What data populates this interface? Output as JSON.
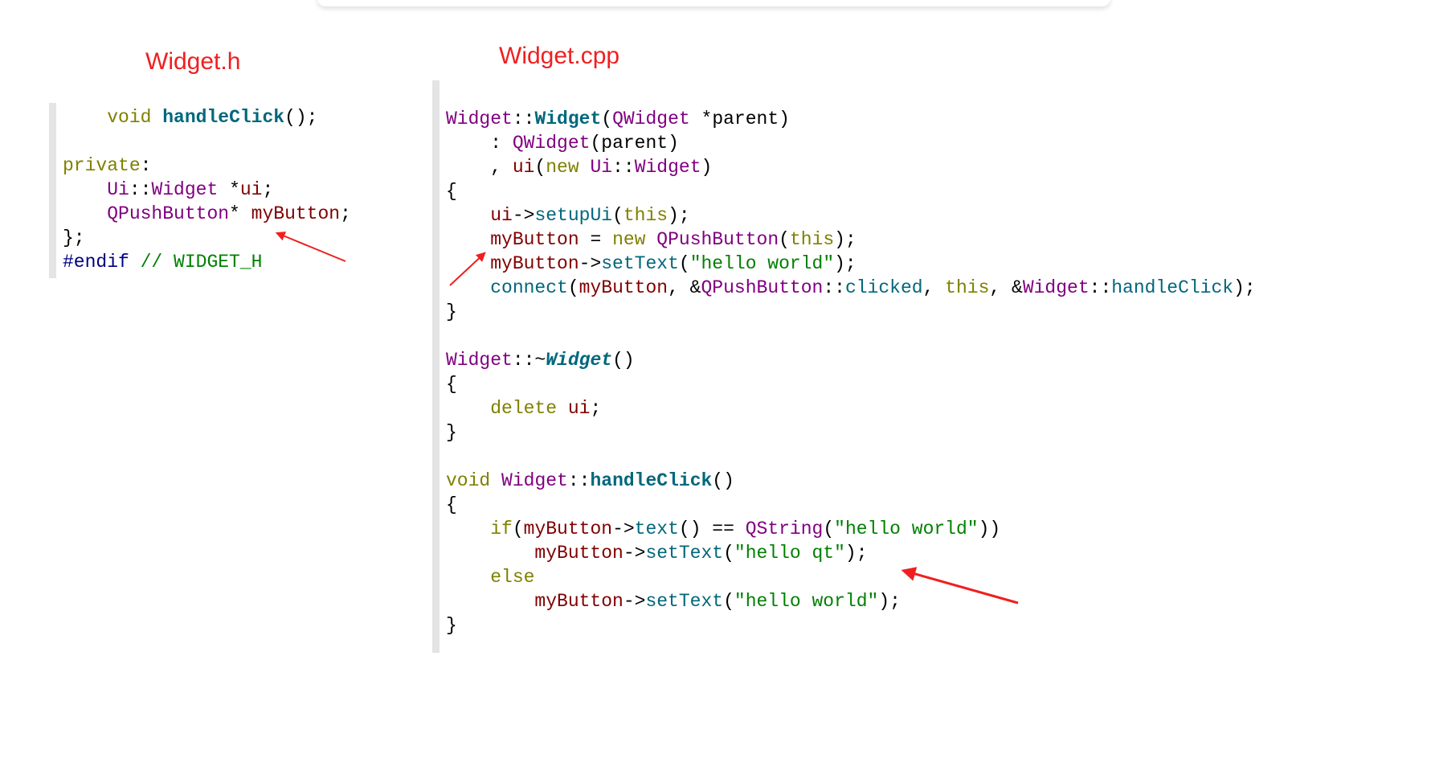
{
  "titles": {
    "header_file": "Widget.h",
    "source_file": "Widget.cpp"
  },
  "colors": {
    "annotation": "#f01f1f",
    "keyword": "#808000",
    "type": "#800080",
    "function": "#00677c",
    "member": "#800000",
    "string": "#008000",
    "preprocessor": "#000080"
  },
  "header_code": [
    [
      [
        "    ",
        "op"
      ],
      [
        "void",
        "kw"
      ],
      [
        " ",
        "op"
      ],
      [
        "handleClick",
        "fn"
      ],
      [
        "();",
        "op"
      ]
    ],
    [],
    [
      [
        "private",
        "kw"
      ],
      [
        ":",
        "op"
      ]
    ],
    [
      [
        "    ",
        "op"
      ],
      [
        "Ui",
        "type"
      ],
      [
        "::",
        "op"
      ],
      [
        "Widget",
        "type"
      ],
      [
        " *",
        "op"
      ],
      [
        "ui",
        "var"
      ],
      [
        ";",
        "op"
      ]
    ],
    [
      [
        "    ",
        "op"
      ],
      [
        "QPushButton",
        "type"
      ],
      [
        "* ",
        "op"
      ],
      [
        "myButton",
        "var"
      ],
      [
        ";",
        "op"
      ]
    ],
    [
      [
        "};",
        "op"
      ]
    ],
    [
      [
        "#endif",
        "pre"
      ],
      [
        " // WIDGET_H",
        "cmt"
      ]
    ]
  ],
  "source_code": [
    [],
    [
      [
        "Widget",
        "type"
      ],
      [
        "::",
        "op"
      ],
      [
        "Widget",
        "fn"
      ],
      [
        "(",
        "op"
      ],
      [
        "QWidget",
        "type"
      ],
      [
        " *",
        "op"
      ],
      [
        "parent",
        "op"
      ],
      [
        ")",
        "op"
      ]
    ],
    [
      [
        "    : ",
        "op"
      ],
      [
        "QWidget",
        "type"
      ],
      [
        "(",
        "op"
      ],
      [
        "parent",
        "op"
      ],
      [
        ")",
        "op"
      ]
    ],
    [
      [
        "    , ",
        "op"
      ],
      [
        "ui",
        "var"
      ],
      [
        "(",
        "op"
      ],
      [
        "new",
        "kw"
      ],
      [
        " ",
        "op"
      ],
      [
        "Ui",
        "type"
      ],
      [
        "::",
        "op"
      ],
      [
        "Widget",
        "type"
      ],
      [
        ")",
        "op"
      ]
    ],
    [
      [
        "{",
        "op"
      ]
    ],
    [
      [
        "    ",
        "op"
      ],
      [
        "ui",
        "var"
      ],
      [
        "->",
        "op"
      ],
      [
        "setupUi",
        "call"
      ],
      [
        "(",
        "op"
      ],
      [
        "this",
        "kw"
      ],
      [
        ");",
        "op"
      ]
    ],
    [
      [
        "    ",
        "op"
      ],
      [
        "myButton",
        "var"
      ],
      [
        " = ",
        "op"
      ],
      [
        "new",
        "kw"
      ],
      [
        " ",
        "op"
      ],
      [
        "QPushButton",
        "type"
      ],
      [
        "(",
        "op"
      ],
      [
        "this",
        "kw"
      ],
      [
        ");",
        "op"
      ]
    ],
    [
      [
        "    ",
        "op"
      ],
      [
        "myButton",
        "var"
      ],
      [
        "->",
        "op"
      ],
      [
        "setText",
        "call"
      ],
      [
        "(",
        "op"
      ],
      [
        "\"hello world\"",
        "str"
      ],
      [
        ");",
        "op"
      ]
    ],
    [
      [
        "    ",
        "op"
      ],
      [
        "connect",
        "call"
      ],
      [
        "(",
        "op"
      ],
      [
        "myButton",
        "var"
      ],
      [
        ", &",
        "op"
      ],
      [
        "QPushButton",
        "type"
      ],
      [
        "::",
        "op"
      ],
      [
        "clicked",
        "call"
      ],
      [
        ", ",
        "op"
      ],
      [
        "this",
        "kw"
      ],
      [
        ", &",
        "op"
      ],
      [
        "Widget",
        "type"
      ],
      [
        "::",
        "op"
      ],
      [
        "handleClick",
        "call"
      ],
      [
        ");",
        "op"
      ]
    ],
    [
      [
        "}",
        "op"
      ]
    ],
    [],
    [
      [
        "Widget",
        "type"
      ],
      [
        "::~",
        "op"
      ],
      [
        "Widget",
        "fni"
      ],
      [
        "()",
        "op"
      ]
    ],
    [
      [
        "{",
        "op"
      ]
    ],
    [
      [
        "    ",
        "op"
      ],
      [
        "delete",
        "kw"
      ],
      [
        " ",
        "op"
      ],
      [
        "ui",
        "var"
      ],
      [
        ";",
        "op"
      ]
    ],
    [
      [
        "}",
        "op"
      ]
    ],
    [],
    [
      [
        "void",
        "kw"
      ],
      [
        " ",
        "op"
      ],
      [
        "Widget",
        "type"
      ],
      [
        "::",
        "op"
      ],
      [
        "handleClick",
        "fn"
      ],
      [
        "()",
        "op"
      ]
    ],
    [
      [
        "{",
        "op"
      ]
    ],
    [
      [
        "    ",
        "op"
      ],
      [
        "if",
        "kw"
      ],
      [
        "(",
        "op"
      ],
      [
        "myButton",
        "var"
      ],
      [
        "->",
        "op"
      ],
      [
        "text",
        "call"
      ],
      [
        "() == ",
        "op"
      ],
      [
        "QString",
        "type"
      ],
      [
        "(",
        "op"
      ],
      [
        "\"hello world\"",
        "str"
      ],
      [
        "))",
        "op"
      ]
    ],
    [
      [
        "        ",
        "op"
      ],
      [
        "myButton",
        "var"
      ],
      [
        "->",
        "op"
      ],
      [
        "setText",
        "call"
      ],
      [
        "(",
        "op"
      ],
      [
        "\"hello qt\"",
        "str"
      ],
      [
        ");",
        "op"
      ]
    ],
    [
      [
        "    ",
        "op"
      ],
      [
        "else",
        "kw"
      ]
    ],
    [
      [
        "        ",
        "op"
      ],
      [
        "myButton",
        "var"
      ],
      [
        "->",
        "op"
      ],
      [
        "setText",
        "call"
      ],
      [
        "(",
        "op"
      ],
      [
        "\"hello world\"",
        "str"
      ],
      [
        ");",
        "op"
      ]
    ],
    [
      [
        "}",
        "op"
      ]
    ]
  ]
}
